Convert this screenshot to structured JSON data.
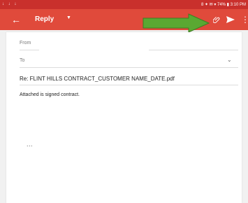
{
  "status_bar": {
    "left_icons": "↓ ↓ ↓",
    "right_text": "8 ✦ ✉ ▾ 74% ▮ 3:10 PM"
  },
  "toolbar": {
    "back_glyph": "←",
    "title": "Reply",
    "dropdown_glyph": "▼",
    "more_glyph": "⋮"
  },
  "compose": {
    "from_label": "From",
    "to_label": "To",
    "to_chevron": "⌄",
    "subject": "Re: FLINT HILLS CONTRACT_CUSTOMER NAME_DATE.pdf",
    "body": "Attached is signed contract.",
    "quoted_text_toggle": "..."
  },
  "colors": {
    "toolbar": "#e04a3b",
    "status_bar": "#c9302c",
    "annotation_arrow": "#5aa832"
  }
}
